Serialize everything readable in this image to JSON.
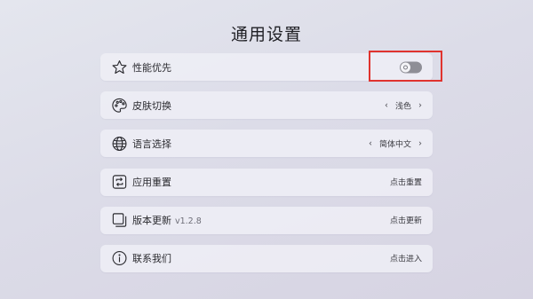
{
  "page": {
    "title": "通用设置"
  },
  "settings": [
    {
      "name": "performance",
      "icon": "star-icon",
      "label": "性能优先",
      "control": "toggle",
      "toggle_on": false
    },
    {
      "name": "skin",
      "icon": "palette-icon",
      "label": "皮肤切换",
      "control": "selector",
      "value": "浅色",
      "left_arrow": "‹",
      "right_arrow": "›"
    },
    {
      "name": "language",
      "icon": "globe-icon",
      "label": "语言选择",
      "control": "selector",
      "value": "简体中文",
      "left_arrow": "‹",
      "right_arrow": "›"
    },
    {
      "name": "reset",
      "icon": "reset-icon",
      "label": "应用重置",
      "control": "action",
      "action_text": "点击重置"
    },
    {
      "name": "update",
      "icon": "pages-icon",
      "label": "版本更新",
      "version": "v1.2.8",
      "control": "action",
      "action_text": "点击更新"
    },
    {
      "name": "contact",
      "icon": "info-icon",
      "label": "联系我们",
      "control": "action",
      "action_text": "点击进入"
    }
  ],
  "colors": {
    "highlight": "#e0332e",
    "toggle_track": "#8e8e96"
  }
}
